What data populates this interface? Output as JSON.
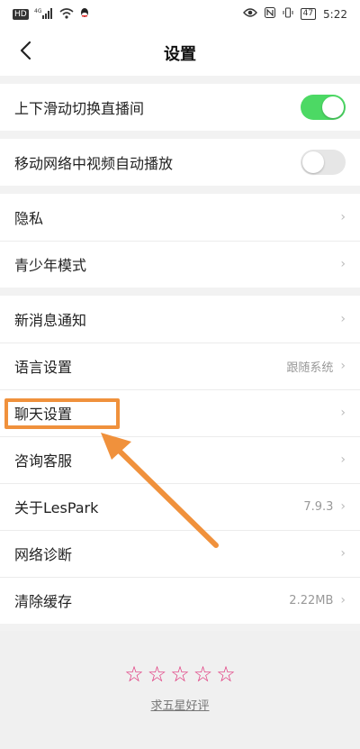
{
  "status_bar": {
    "network_chip": "HD",
    "signal_label": "4G",
    "battery": "47",
    "time": "5:22"
  },
  "header": {
    "title": "设置"
  },
  "settings": {
    "toggles": [
      {
        "label": "上下滑动切换直播间",
        "on": true
      },
      {
        "label": "移动网络中视频自动播放",
        "on": false
      }
    ],
    "group_privacy": [
      {
        "label": "隐私"
      },
      {
        "label": "青少年模式"
      }
    ],
    "group_general": [
      {
        "label": "新消息通知",
        "value": ""
      },
      {
        "label": "语言设置",
        "value": "跟随系统"
      },
      {
        "label": "聊天设置",
        "value": ""
      },
      {
        "label": "咨询客服",
        "value": ""
      },
      {
        "label": "关于LesPark",
        "value": "7.9.3"
      },
      {
        "label": "网络诊断",
        "value": ""
      },
      {
        "label": "清除缓存",
        "value": "2.22MB"
      }
    ]
  },
  "rating": {
    "stars": 5,
    "link_text": "求五星好评"
  },
  "colors": {
    "toggle_on": "#4cd964",
    "star": "#e0337a",
    "annotation": "#f0913c"
  }
}
